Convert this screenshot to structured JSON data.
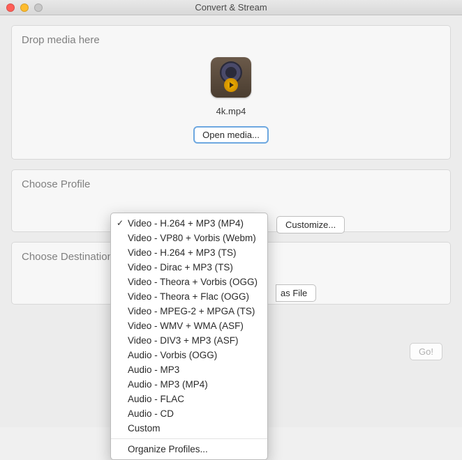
{
  "window": {
    "title": "Convert & Stream"
  },
  "drop": {
    "heading": "Drop media here",
    "filename": "4k.mp4",
    "open_label": "Open media..."
  },
  "profile": {
    "heading": "Choose Profile",
    "customize_label": "Customize...",
    "selected": "Video - H.264 + MP3 (MP4)",
    "options": [
      "Video - H.264 + MP3 (MP4)",
      "Video - VP80 + Vorbis (Webm)",
      "Video - H.264 + MP3 (TS)",
      "Video - Dirac + MP3 (TS)",
      "Video - Theora + Vorbis (OGG)",
      "Video - Theora + Flac (OGG)",
      "Video - MPEG-2 + MPGA (TS)",
      "Video - WMV + WMA (ASF)",
      "Video - DIV3 + MP3 (ASF)",
      "Audio - Vorbis (OGG)",
      "Audio - MP3",
      "Audio - MP3 (MP4)",
      "Audio - FLAC",
      "Audio - CD",
      "Custom"
    ],
    "organize_label": "Organize Profiles..."
  },
  "dest": {
    "heading": "Choose Destination",
    "as_file_label": "as File"
  },
  "actions": {
    "go_label": "Go!"
  }
}
